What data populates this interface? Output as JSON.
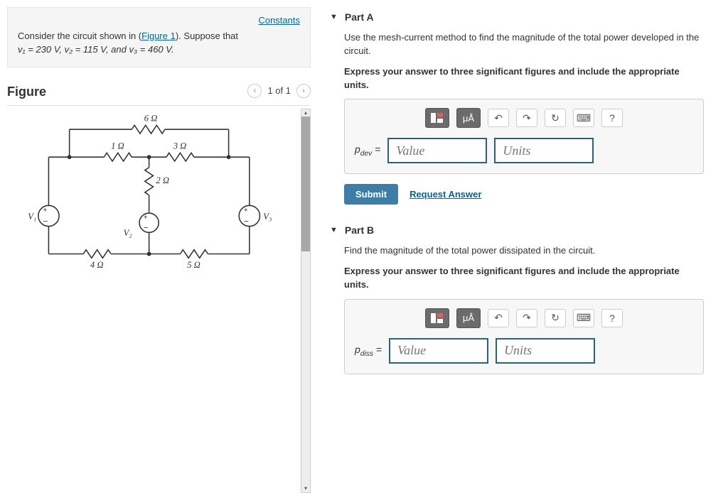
{
  "left": {
    "constants_link": "Constants",
    "problem_html_prefix": "Consider the circuit shown in (",
    "figure_link": "Figure 1",
    "problem_html_mid": "). Suppose that ",
    "problem_values": "v₁ = 230 V, v₂ = 115 V, and v₃ = 460 V.",
    "figure_heading": "Figure",
    "fig_counter": "1 of 1",
    "circuit": {
      "R_top": "6 Ω",
      "R_left": "1 Ω",
      "R_right": "3 Ω",
      "R_mid": "2 Ω",
      "R_bottom_left": "4 Ω",
      "R_bottom_right": "5 Ω",
      "V1": "V₁",
      "V2": "V₂",
      "V3": "V₃"
    }
  },
  "right": {
    "partA": {
      "title": "Part A",
      "instruction": "Use the mesh-current method to find the magnitude of the total power developed in the circuit.",
      "express": "Express your answer to three significant figures and include the appropriate units.",
      "label_main": "p",
      "label_sub": "dev",
      "value_placeholder": "Value",
      "units_placeholder": "Units",
      "submit": "Submit",
      "request": "Request Answer"
    },
    "partB": {
      "title": "Part B",
      "instruction": "Find the magnitude of the total power dissipated in the circuit.",
      "express": "Express your answer to three significant figures and include the appropriate units.",
      "label_main": "p",
      "label_sub": "diss",
      "value_placeholder": "Value",
      "units_placeholder": "Units"
    },
    "toolbar": {
      "units_label": "μÅ",
      "help": "?"
    }
  }
}
